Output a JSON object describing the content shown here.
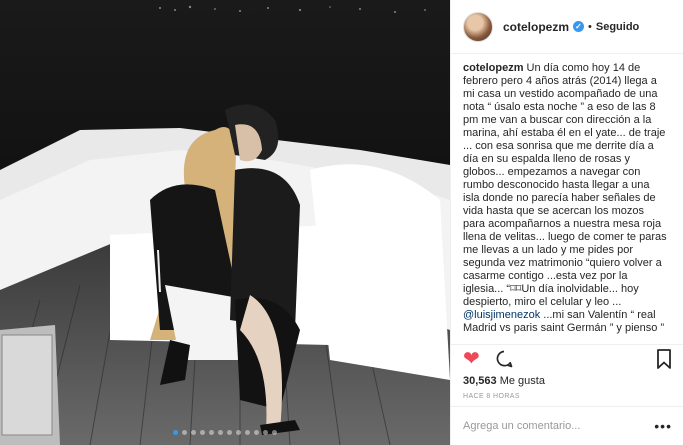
{
  "post": {
    "username": "cotelopezm",
    "verified_mark": "✓",
    "separator": "•",
    "follow_label": "Seguido",
    "caption_user": "cotelopezm",
    "caption_text_1": "Un día como hoy 14 de febrero pero 4 años atrás (2014) llega a mi casa un vestido acompañado de una nota “ úsalo esta noche ” a eso de las 8 pm me van a buscar con dirección a la marina, ahí estaba él en el yate... de traje ... con esa sonrisa que me derrite día a día en su espalda lleno de rosas y globos... empezamos a navegar con rumbo desconocido hasta llegar a una isla donde no parecía haber señales de vida hasta que se acercan los mozos para acompañarnos a nuestra mesa roja llena de velitas... luego de comer te paras me llevas a un lado y me pides por segunda vez matrimonio “quiero volver a casarme contigo ...esta vez por la iglesia... “⌑⌑Un día inolvidable... hoy despierto, miro el celular y leo ... ",
    "mention": "@luisjimenezok",
    "caption_text_2": " ...mi san Valentín “ real Madrid vs paris saint Germán ” y pienso ” que “xuuuuxa⌑” ... pero ¡q te pasó",
    "likes_count": "30,563",
    "likes_label": "Me gusta",
    "timestamp": "HACE 8 HORAS",
    "comment_placeholder": "Agrega un comentario...",
    "more_label": "•••",
    "carousel_total": 12,
    "carousel_active": 0
  },
  "icons": {
    "heart": "heart-icon",
    "comment": "comment-icon",
    "bookmark": "bookmark-icon",
    "verified": "verified-badge-icon"
  },
  "colors": {
    "like_red": "#ed4956",
    "link_blue": "#003569",
    "verified_blue": "#3897f0",
    "meta_gray": "#999999"
  }
}
